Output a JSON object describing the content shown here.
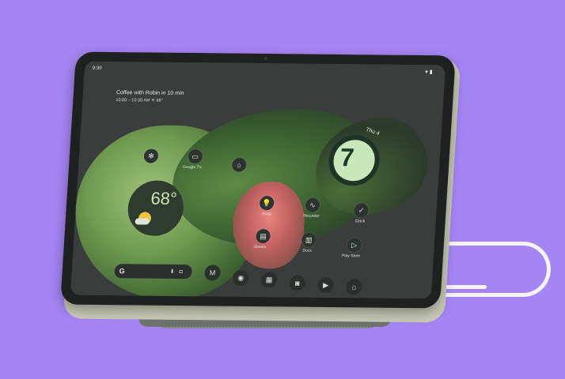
{
  "status_bar": {
    "time": "9:30",
    "icons": [
      "wifi-icon",
      "battery-icon"
    ]
  },
  "glance": {
    "title": "Coffee with Robin in 10 min",
    "subtitle": "10:00 – 10:30 AM  ☀ 68°"
  },
  "weather": {
    "temperature": "68°"
  },
  "clock": {
    "hour": "7",
    "date": "Thu 4"
  },
  "apps": [
    {
      "label": ""
    },
    {
      "label": "Google TV"
    },
    {
      "label": ""
    },
    {
      "label": "Keep"
    },
    {
      "label": "Recorder"
    },
    {
      "label": "Clock"
    },
    {
      "label": "Sheets"
    },
    {
      "label": "Docs"
    },
    {
      "label": "Play Store"
    }
  ],
  "search": {
    "logo": "G",
    "icons": [
      "mic-icon",
      "lens-icon"
    ]
  },
  "dock_apps": [
    "gmail-icon",
    "chrome-icon",
    "calendar-icon",
    "camera-icon",
    "youtube-icon",
    "home-icon"
  ]
}
